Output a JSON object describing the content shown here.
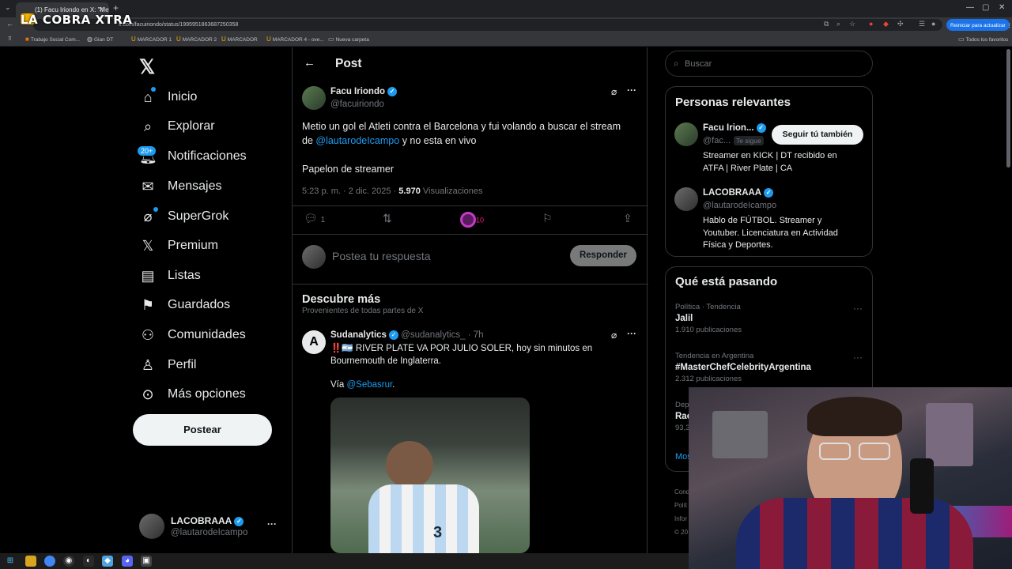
{
  "browser": {
    "tab_title": "(1) Facu Iriondo en X: \"Metio u",
    "url": "x.com/facuiriondo/status/1995951863687250358",
    "update_button": "Reiniciar para actualizar",
    "bookmarks": [
      "Trabajo Social Com...",
      "Gian DT",
      "MARCADOR 1",
      "MARCADOR 2",
      "MARCADOR",
      "MARCADOR 4 - ove...",
      "Nueva carpeta"
    ],
    "all_bookmarks": "Todos los favoritos"
  },
  "watermark": "LA COBRA XTRA",
  "nav": {
    "items": [
      {
        "label": "Inicio",
        "icon": "home-icon"
      },
      {
        "label": "Explorar",
        "icon": "search-icon"
      },
      {
        "label": "Notificaciones",
        "icon": "bell-icon"
      },
      {
        "label": "Mensajes",
        "icon": "mail-icon"
      },
      {
        "label": "SuperGrok",
        "icon": "grok-icon"
      },
      {
        "label": "Premium",
        "icon": "x-icon"
      },
      {
        "label": "Listas",
        "icon": "list-icon"
      },
      {
        "label": "Guardados",
        "icon": "bookmark-icon"
      },
      {
        "label": "Comunidades",
        "icon": "people-icon"
      },
      {
        "label": "Perfil",
        "icon": "user-icon"
      },
      {
        "label": "Más opciones",
        "icon": "more-icon"
      }
    ],
    "notifications_badge": "20+",
    "post_button": "Postear"
  },
  "account": {
    "name": "LACOBRAAA",
    "handle": "@lautarodeIcampo"
  },
  "post_header": {
    "title": "Post"
  },
  "post": {
    "author_name": "Facu Iriondo",
    "author_handle": "@facuiriondo",
    "text_line1": "Metio un gol el Atleti contra el Barcelona y fui volando a buscar el stream",
    "text_line2_prefix": "de",
    "mention": "@lautarodeIcampo",
    "text_line2_suffix": "y no esta en vivo",
    "text_line3": "Papelon de streamer",
    "time": "5:23 p. m. · 2 dic. 2025 ·",
    "views_count": "5.970",
    "views_label": "Visualizaciones",
    "replies": "1",
    "likes": "10"
  },
  "reply": {
    "placeholder": "Postea tu respuesta",
    "button": "Responder"
  },
  "discover": {
    "title": "Descubre más",
    "subtitle": "Provenientes de todas partes de X",
    "post": {
      "author_name": "Sudanalytics",
      "author_handle": "@sudanalytics_",
      "age": "· 7h",
      "line1": "‼️🇦🇷 RIVER PLATE VA POR JULIO SOLER, hoy sin minutos en",
      "line2": "Bournemouth de Inglaterra.",
      "via_prefix": "Vía",
      "via_mention": "@Sebasrur",
      "jersey_number": "3"
    }
  },
  "right": {
    "search_placeholder": "Buscar",
    "relevant": {
      "title": "Personas relevantes",
      "people": [
        {
          "name": "Facu Irion...",
          "handle": "@fac...",
          "follows_you": "Te sigue",
          "bio1": "Streamer en KICK | DT recibido en",
          "bio2": "ATFA | River Plate | CA",
          "button": "Seguir tú también"
        },
        {
          "name": "LACOBRAAA",
          "handle": "@lautarodeIcampo",
          "bio1": "Hablo de FÚTBOL. Streamer y",
          "bio2": "Youtuber. Licenciatura en Actividad",
          "bio3": "Física y Deportes."
        }
      ]
    },
    "trends": {
      "title": "Qué está pasando",
      "items": [
        {
          "context": "Política · Tendencia",
          "name": "Jalil",
          "count": "1.910 publicaciones"
        },
        {
          "context": "Tendencia en Argentina",
          "name": "#MasterChefCelebrityArgentina",
          "count": "2.312 publicaciones"
        },
        {
          "context": "Dep",
          "name": "Rac",
          "count": "93,3"
        }
      ],
      "more": "Mos"
    }
  },
  "footer_partial": [
    "Cond",
    "Polít",
    "Infor",
    "© 20"
  ]
}
